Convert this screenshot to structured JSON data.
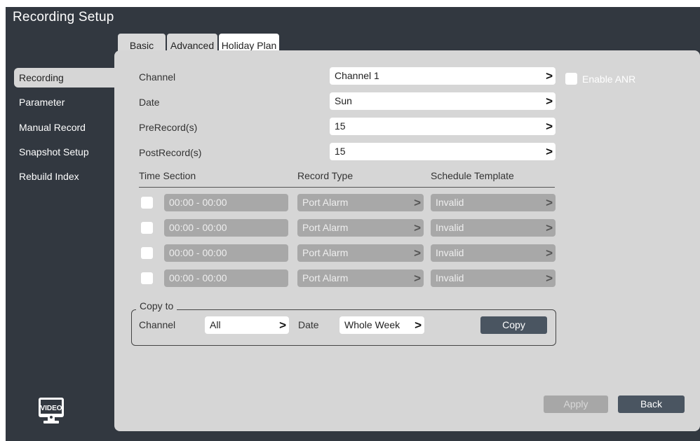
{
  "app_title": "Recording Setup",
  "tabs": [
    {
      "label": "Basic"
    },
    {
      "label": "Advanced"
    },
    {
      "label": "Holiday Plan"
    }
  ],
  "sidebar": {
    "items": [
      {
        "label": "Recording",
        "active": true
      },
      {
        "label": "Parameter"
      },
      {
        "label": "Manual Record"
      },
      {
        "label": "Snapshot Setup"
      },
      {
        "label": "Rebuild Index"
      }
    ],
    "logo_text": "VIDEO"
  },
  "form": {
    "channel": {
      "label": "Channel",
      "value": "Channel 1"
    },
    "date": {
      "label": "Date",
      "value": "Sun"
    },
    "prerecord": {
      "label": "PreRecord(s)",
      "value": "15"
    },
    "postrecord": {
      "label": "PostRecord(s)",
      "value": "15"
    },
    "enable_anr": {
      "label": "Enable ANR",
      "checked": false
    }
  },
  "schedule": {
    "headers": [
      "Time Section",
      "Record Type",
      "Schedule Template"
    ],
    "rows": [
      {
        "time": "00:00 - 00:00",
        "record_type": "Port Alarm",
        "template": "Invalid"
      },
      {
        "time": "00:00 - 00:00",
        "record_type": "Port Alarm",
        "template": "Invalid"
      },
      {
        "time": "00:00 - 00:00",
        "record_type": "Port Alarm",
        "template": "Invalid"
      },
      {
        "time": "00:00 - 00:00",
        "record_type": "Port Alarm",
        "template": "Invalid"
      }
    ]
  },
  "copy_to": {
    "legend": "Copy to",
    "channel_label": "Channel",
    "channel_value": "All",
    "date_label": "Date",
    "date_value": "Whole Week",
    "copy_button": "Copy"
  },
  "footer": {
    "apply_button": "Apply",
    "back_button": "Back"
  },
  "icons": {
    "chevron": "chevron-right-icon",
    "logo": "video-monitor-icon"
  },
  "colors": {
    "frame": "#323840",
    "panel": "#d6d6d6",
    "button": "#4a5561",
    "disabled": "#a8a8a8"
  }
}
